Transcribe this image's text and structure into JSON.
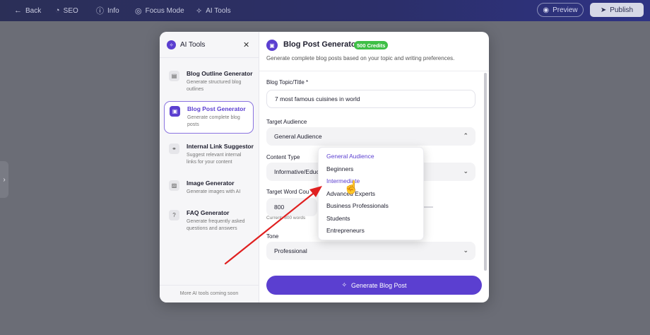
{
  "topbar": {
    "back": "Back",
    "seo": "SEO",
    "info": "Info",
    "focus_mode": "Focus Mode",
    "ai_tools": "AI Tools",
    "preview": "Preview",
    "publish": "Publish"
  },
  "sidebar": {
    "title": "AI Tools",
    "footer": "More AI tools coming soon",
    "tools": [
      {
        "name": "Blog Outline Generator",
        "desc": "Generate structured blog outlines",
        "icon": "document-icon"
      },
      {
        "name": "Blog Post Generator",
        "desc": "Generate complete blog posts",
        "icon": "post-icon"
      },
      {
        "name": "Internal Link Suggestor",
        "desc": "Suggest relevant internal links for your content",
        "icon": "link-icon"
      },
      {
        "name": "Image Generator",
        "desc": "Generate images with AI",
        "icon": "image-icon"
      },
      {
        "name": "FAQ Generator",
        "desc": "Generate frequently asked questions and answers",
        "icon": "question-icon"
      }
    ],
    "active_index": 1
  },
  "main": {
    "title": "Blog Post Generator",
    "credits": "500 Credits",
    "subtitle": "Generate complete blog posts based on your topic and writing preferences.",
    "topic_label": "Blog Topic/Title *",
    "topic_value": "7 most famous cuisines in world",
    "audience_label": "Target Audience",
    "audience_value": "General Audience",
    "content_type_label": "Content Type",
    "content_type_value": "Informative/Educ",
    "word_count_label": "Target Word Cou",
    "word_count_value": "800",
    "word_count_hint": "Current: 800 words",
    "tone_label": "Tone",
    "tone_value": "Professional",
    "generate_button": "Generate Blog Post"
  },
  "dropdown": {
    "options": [
      "General Audience",
      "Beginners",
      "Intermediate",
      "Advanced Experts",
      "Business Professionals",
      "Students",
      "Entrepreneurs"
    ],
    "selected_index": 0,
    "hover_index": 2
  },
  "colors": {
    "accent": "#5b3fd0",
    "credits_badge": "#3fbf46",
    "topbar": "#2c2f6a"
  }
}
